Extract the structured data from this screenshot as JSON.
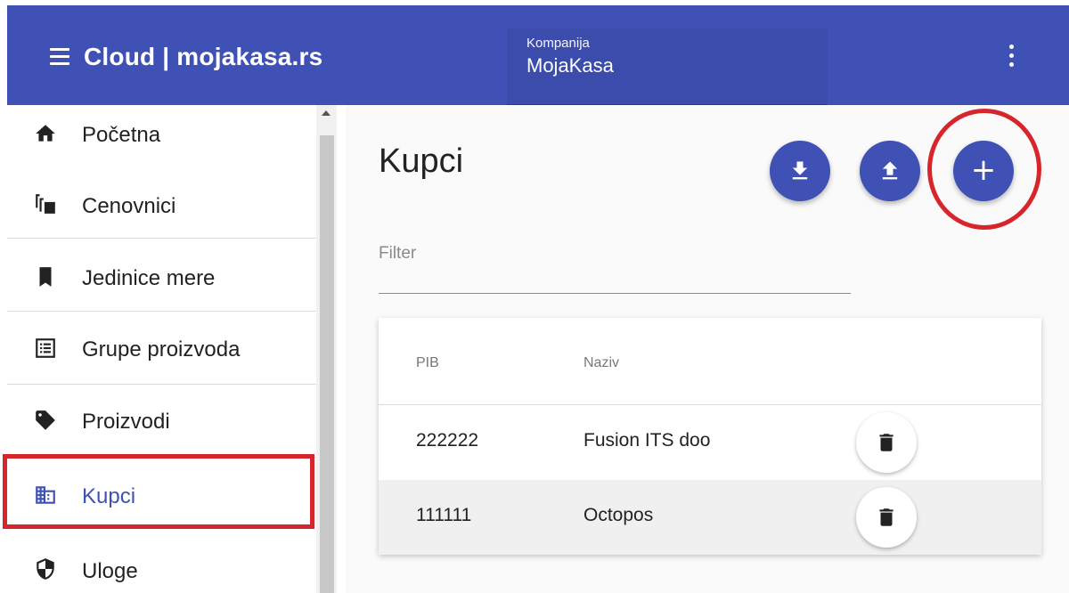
{
  "appbar": {
    "title": "Cloud | mojakasa.rs",
    "company_label": "Kompanija",
    "company_value": "MojaKasa",
    "menu_icon": "hamburger-menu-icon",
    "more_icon": "more-vertical-icon",
    "background": "#3f51b5"
  },
  "sidebar": {
    "items": [
      {
        "label": "Početna",
        "icon": "home-icon"
      },
      {
        "label": "Cenovnici",
        "icon": "library-icon"
      },
      {
        "label": "Jedinice mere",
        "icon": "bookmark-icon"
      },
      {
        "label": "Grupe proizvoda",
        "icon": "list-alt-icon"
      },
      {
        "label": "Proizvodi",
        "icon": "tag-icon"
      },
      {
        "label": "Kupci",
        "icon": "business-icon",
        "active": true
      },
      {
        "label": "Uloge",
        "icon": "shield-icon"
      }
    ],
    "active_color": "#3f51b5",
    "highlight_color": "#d6262c"
  },
  "main": {
    "title": "Kupci",
    "filter_placeholder": "Filter",
    "actions": [
      {
        "name": "download",
        "icon": "download-icon"
      },
      {
        "name": "upload",
        "icon": "upload-icon"
      },
      {
        "name": "add",
        "icon": "plus-icon",
        "symbol": "+"
      }
    ],
    "table": {
      "columns": [
        "PIB",
        "Naziv"
      ],
      "rows": [
        {
          "pib": "222222",
          "naziv": "Fusion ITS doo"
        },
        {
          "pib": "111111",
          "naziv": "Octopos"
        }
      ],
      "row_action_icon": "delete-icon"
    }
  }
}
